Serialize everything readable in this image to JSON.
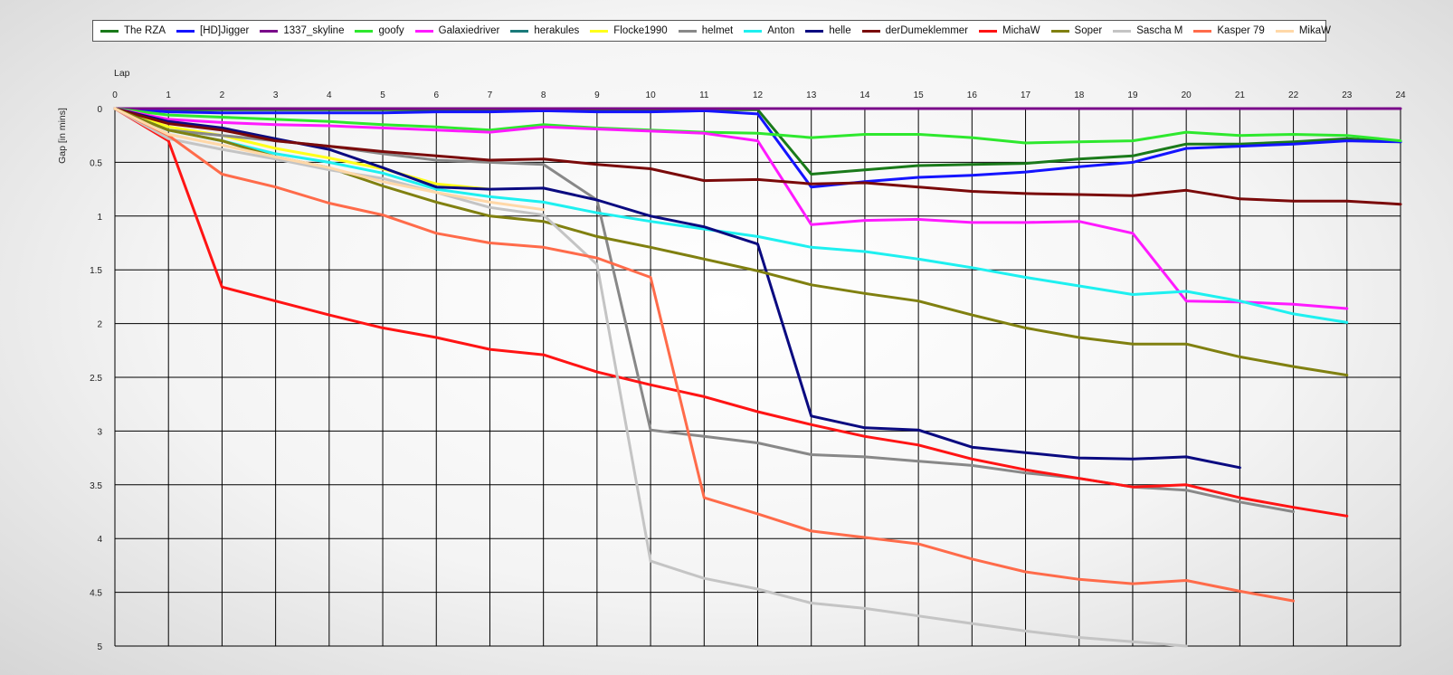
{
  "chart_data": {
    "type": "line",
    "xlabel": "Lap",
    "ylabel": "Gap [in mins]",
    "xlim": [
      0,
      24
    ],
    "ylim": [
      0,
      5
    ],
    "y_inverted": true,
    "grid": true,
    "legend_position": "top",
    "x_ticks": [
      0,
      1,
      2,
      3,
      4,
      5,
      6,
      7,
      8,
      9,
      10,
      11,
      12,
      13,
      14,
      15,
      16,
      17,
      18,
      19,
      20,
      21,
      22,
      23,
      24
    ],
    "y_ticks": [
      0,
      0.5,
      1,
      1.5,
      2,
      2.5,
      3,
      3.5,
      4,
      4.5,
      5
    ],
    "series": [
      {
        "name": "The RZA",
        "color": "#1a7a1a",
        "x": [
          0,
          1,
          2,
          3,
          4,
          5,
          6,
          7,
          8,
          9,
          10,
          11,
          12,
          13,
          14,
          15,
          16,
          17,
          18,
          19,
          20,
          21,
          22,
          23,
          24
        ],
        "values": [
          0,
          0.01,
          0.01,
          0.01,
          0.01,
          0.01,
          0.01,
          0.01,
          0.01,
          0.01,
          0.01,
          0.01,
          0.01,
          0.61,
          0.57,
          0.53,
          0.52,
          0.51,
          0.47,
          0.44,
          0.33,
          0.33,
          0.31,
          0.28,
          0.31
        ]
      },
      {
        "name": "[HD]Jigger",
        "color": "#1414ff",
        "x": [
          0,
          1,
          2,
          3,
          4,
          5,
          6,
          7,
          8,
          9,
          10,
          11,
          12,
          13,
          14,
          15,
          16,
          17,
          18,
          19,
          20,
          21,
          22,
          23,
          24
        ],
        "values": [
          0,
          0.03,
          0.04,
          0.04,
          0.04,
          0.04,
          0.03,
          0.03,
          0.02,
          0.03,
          0.03,
          0.02,
          0.05,
          0.73,
          0.68,
          0.64,
          0.62,
          0.59,
          0.54,
          0.5,
          0.37,
          0.35,
          0.33,
          0.3,
          0.31
        ]
      },
      {
        "name": "1337_skyline",
        "color": "#7a0a8a",
        "x": [
          0,
          1,
          2,
          3,
          4,
          5,
          6,
          7,
          8,
          9,
          10,
          11,
          12,
          13,
          14,
          15,
          16,
          17,
          18,
          19,
          20,
          21,
          22,
          23,
          24
        ],
        "values": [
          0,
          0,
          0,
          0,
          0,
          0,
          0,
          0,
          0,
          0,
          0,
          0,
          0,
          0,
          0,
          0,
          0,
          0,
          0,
          0,
          0,
          0,
          0,
          0,
          0
        ]
      },
      {
        "name": "goofy",
        "color": "#2ee82e",
        "x": [
          0,
          1,
          2,
          3,
          4,
          5,
          6,
          7,
          8,
          9,
          10,
          11,
          12,
          13,
          14,
          15,
          16,
          17,
          18,
          19,
          20,
          21,
          22,
          23,
          24
        ],
        "values": [
          0,
          0.06,
          0.08,
          0.1,
          0.12,
          0.15,
          0.17,
          0.2,
          0.15,
          0.18,
          0.2,
          0.22,
          0.23,
          0.27,
          0.24,
          0.24,
          0.27,
          0.32,
          0.31,
          0.3,
          0.22,
          0.25,
          0.24,
          0.25,
          0.3
        ]
      },
      {
        "name": "Galaxiedriver",
        "color": "#ff1aff",
        "x": [
          0,
          1,
          2,
          3,
          4,
          5,
          6,
          7,
          8,
          9,
          10,
          11,
          12,
          13,
          14,
          15,
          16,
          17,
          18,
          19,
          20,
          21,
          22,
          23
        ],
        "values": [
          0,
          0.1,
          0.13,
          0.15,
          0.16,
          0.18,
          0.2,
          0.22,
          0.17,
          0.19,
          0.21,
          0.23,
          0.3,
          1.08,
          1.04,
          1.03,
          1.06,
          1.06,
          1.05,
          1.16,
          1.79,
          1.8,
          1.82,
          1.86
        ]
      },
      {
        "name": "herakules",
        "color": "#1a7a7a",
        "x": [
          0,
          1
        ],
        "values": [
          0,
          0.2
        ]
      },
      {
        "name": "Flocke1990",
        "color": "#ffff1a",
        "x": [
          0,
          1,
          2,
          3,
          4,
          5,
          6,
          7
        ],
        "values": [
          0,
          0.17,
          0.25,
          0.37,
          0.46,
          0.56,
          0.7,
          0.75
        ]
      },
      {
        "name": "helmet",
        "color": "#888888",
        "x": [
          0,
          1,
          2,
          3,
          4,
          5,
          6,
          7,
          8,
          9,
          10,
          11,
          12,
          13,
          14,
          15,
          16,
          17,
          18,
          19,
          20,
          21,
          22
        ],
        "values": [
          0,
          0.2,
          0.25,
          0.3,
          0.35,
          0.42,
          0.48,
          0.5,
          0.52,
          0.85,
          2.99,
          3.05,
          3.11,
          3.22,
          3.24,
          3.28,
          3.32,
          3.39,
          3.44,
          3.52,
          3.55,
          3.66,
          3.75
        ]
      },
      {
        "name": "Anton",
        "color": "#1ef0f0",
        "x": [
          0,
          1,
          2,
          3,
          4,
          5,
          6,
          7,
          8,
          9,
          10,
          11,
          12,
          13,
          14,
          15,
          16,
          17,
          18,
          19,
          20,
          21,
          22,
          23
        ],
        "values": [
          0,
          0.2,
          0.3,
          0.42,
          0.5,
          0.6,
          0.75,
          0.82,
          0.87,
          0.97,
          1.05,
          1.12,
          1.19,
          1.29,
          1.33,
          1.4,
          1.48,
          1.57,
          1.65,
          1.73,
          1.7,
          1.79,
          1.91,
          1.99
        ]
      },
      {
        "name": "helle",
        "color": "#0a0a80",
        "x": [
          0,
          1,
          2,
          3,
          4,
          5,
          6,
          7,
          8,
          9,
          10,
          11,
          12,
          13,
          14,
          15,
          16,
          17,
          18,
          19,
          20,
          21
        ],
        "values": [
          0,
          0.12,
          0.18,
          0.28,
          0.38,
          0.55,
          0.73,
          0.75,
          0.74,
          0.85,
          1.0,
          1.1,
          1.26,
          2.86,
          2.97,
          2.99,
          3.15,
          3.2,
          3.25,
          3.26,
          3.24,
          3.34
        ]
      },
      {
        "name": "derDumeklemmer",
        "color": "#7a0a0a",
        "x": [
          0,
          1,
          2,
          3,
          4,
          5,
          6,
          7,
          8,
          9,
          10,
          11,
          12,
          13,
          14,
          15,
          16,
          17,
          18,
          19,
          20,
          21,
          22,
          23,
          24
        ],
        "values": [
          0,
          0.14,
          0.2,
          0.3,
          0.35,
          0.4,
          0.44,
          0.48,
          0.47,
          0.52,
          0.56,
          0.67,
          0.66,
          0.7,
          0.69,
          0.73,
          0.77,
          0.79,
          0.8,
          0.81,
          0.76,
          0.84,
          0.86,
          0.86,
          0.89
        ]
      },
      {
        "name": "MichaW",
        "color": "#ff1414",
        "x": [
          0,
          1,
          2,
          3,
          4,
          5,
          6,
          7,
          8,
          9,
          10,
          11,
          12,
          13,
          14,
          15,
          16,
          17,
          18,
          19,
          20,
          21,
          22,
          23
        ],
        "values": [
          0,
          0.3,
          1.66,
          1.79,
          1.92,
          2.04,
          2.13,
          2.24,
          2.29,
          2.45,
          2.57,
          2.68,
          2.82,
          2.94,
          3.05,
          3.13,
          3.26,
          3.36,
          3.44,
          3.52,
          3.5,
          3.62,
          3.71,
          3.79
        ]
      },
      {
        "name": "Soper",
        "color": "#808010",
        "x": [
          0,
          1,
          2,
          3,
          4,
          5,
          6,
          7,
          8,
          9,
          10,
          11,
          12,
          13,
          14,
          15,
          16,
          17,
          18,
          19,
          20,
          21,
          22,
          23
        ],
        "values": [
          0,
          0.2,
          0.3,
          0.45,
          0.55,
          0.72,
          0.87,
          1.0,
          1.05,
          1.19,
          1.29,
          1.4,
          1.51,
          1.64,
          1.72,
          1.79,
          1.92,
          2.04,
          2.13,
          2.19,
          2.19,
          2.31,
          2.4,
          2.48
        ]
      },
      {
        "name": "Sascha M",
        "color": "#c4c4c4",
        "x": [
          0,
          1,
          2,
          3,
          4,
          5,
          6,
          7,
          8,
          9,
          10,
          11,
          12,
          13,
          14,
          15,
          16,
          17,
          18,
          19,
          20
        ],
        "values": [
          0,
          0.28,
          0.38,
          0.47,
          0.57,
          0.65,
          0.78,
          0.92,
          0.99,
          1.45,
          4.21,
          4.37,
          4.47,
          4.6,
          4.65,
          4.72,
          4.79,
          4.86,
          4.92,
          4.96,
          5.0
        ]
      },
      {
        "name": "Kasper 79",
        "color": "#ff6b4a",
        "x": [
          0,
          1,
          2,
          3,
          4,
          5,
          6,
          7,
          8,
          9,
          10,
          11,
          12,
          13,
          14,
          15,
          16,
          17,
          18,
          19,
          20,
          21,
          22
        ],
        "values": [
          0,
          0.25,
          0.61,
          0.73,
          0.88,
          0.99,
          1.16,
          1.25,
          1.29,
          1.39,
          1.57,
          3.62,
          3.77,
          3.93,
          3.99,
          4.05,
          4.19,
          4.31,
          4.38,
          4.42,
          4.39,
          4.49,
          4.58
        ]
      },
      {
        "name": "MikaW",
        "color": "#ffd8a8",
        "x": [
          0,
          1,
          2,
          3,
          4,
          5,
          6,
          7,
          8
        ],
        "values": [
          0,
          0.24,
          0.34,
          0.45,
          0.55,
          0.68,
          0.78,
          0.87,
          0.94
        ]
      }
    ]
  }
}
